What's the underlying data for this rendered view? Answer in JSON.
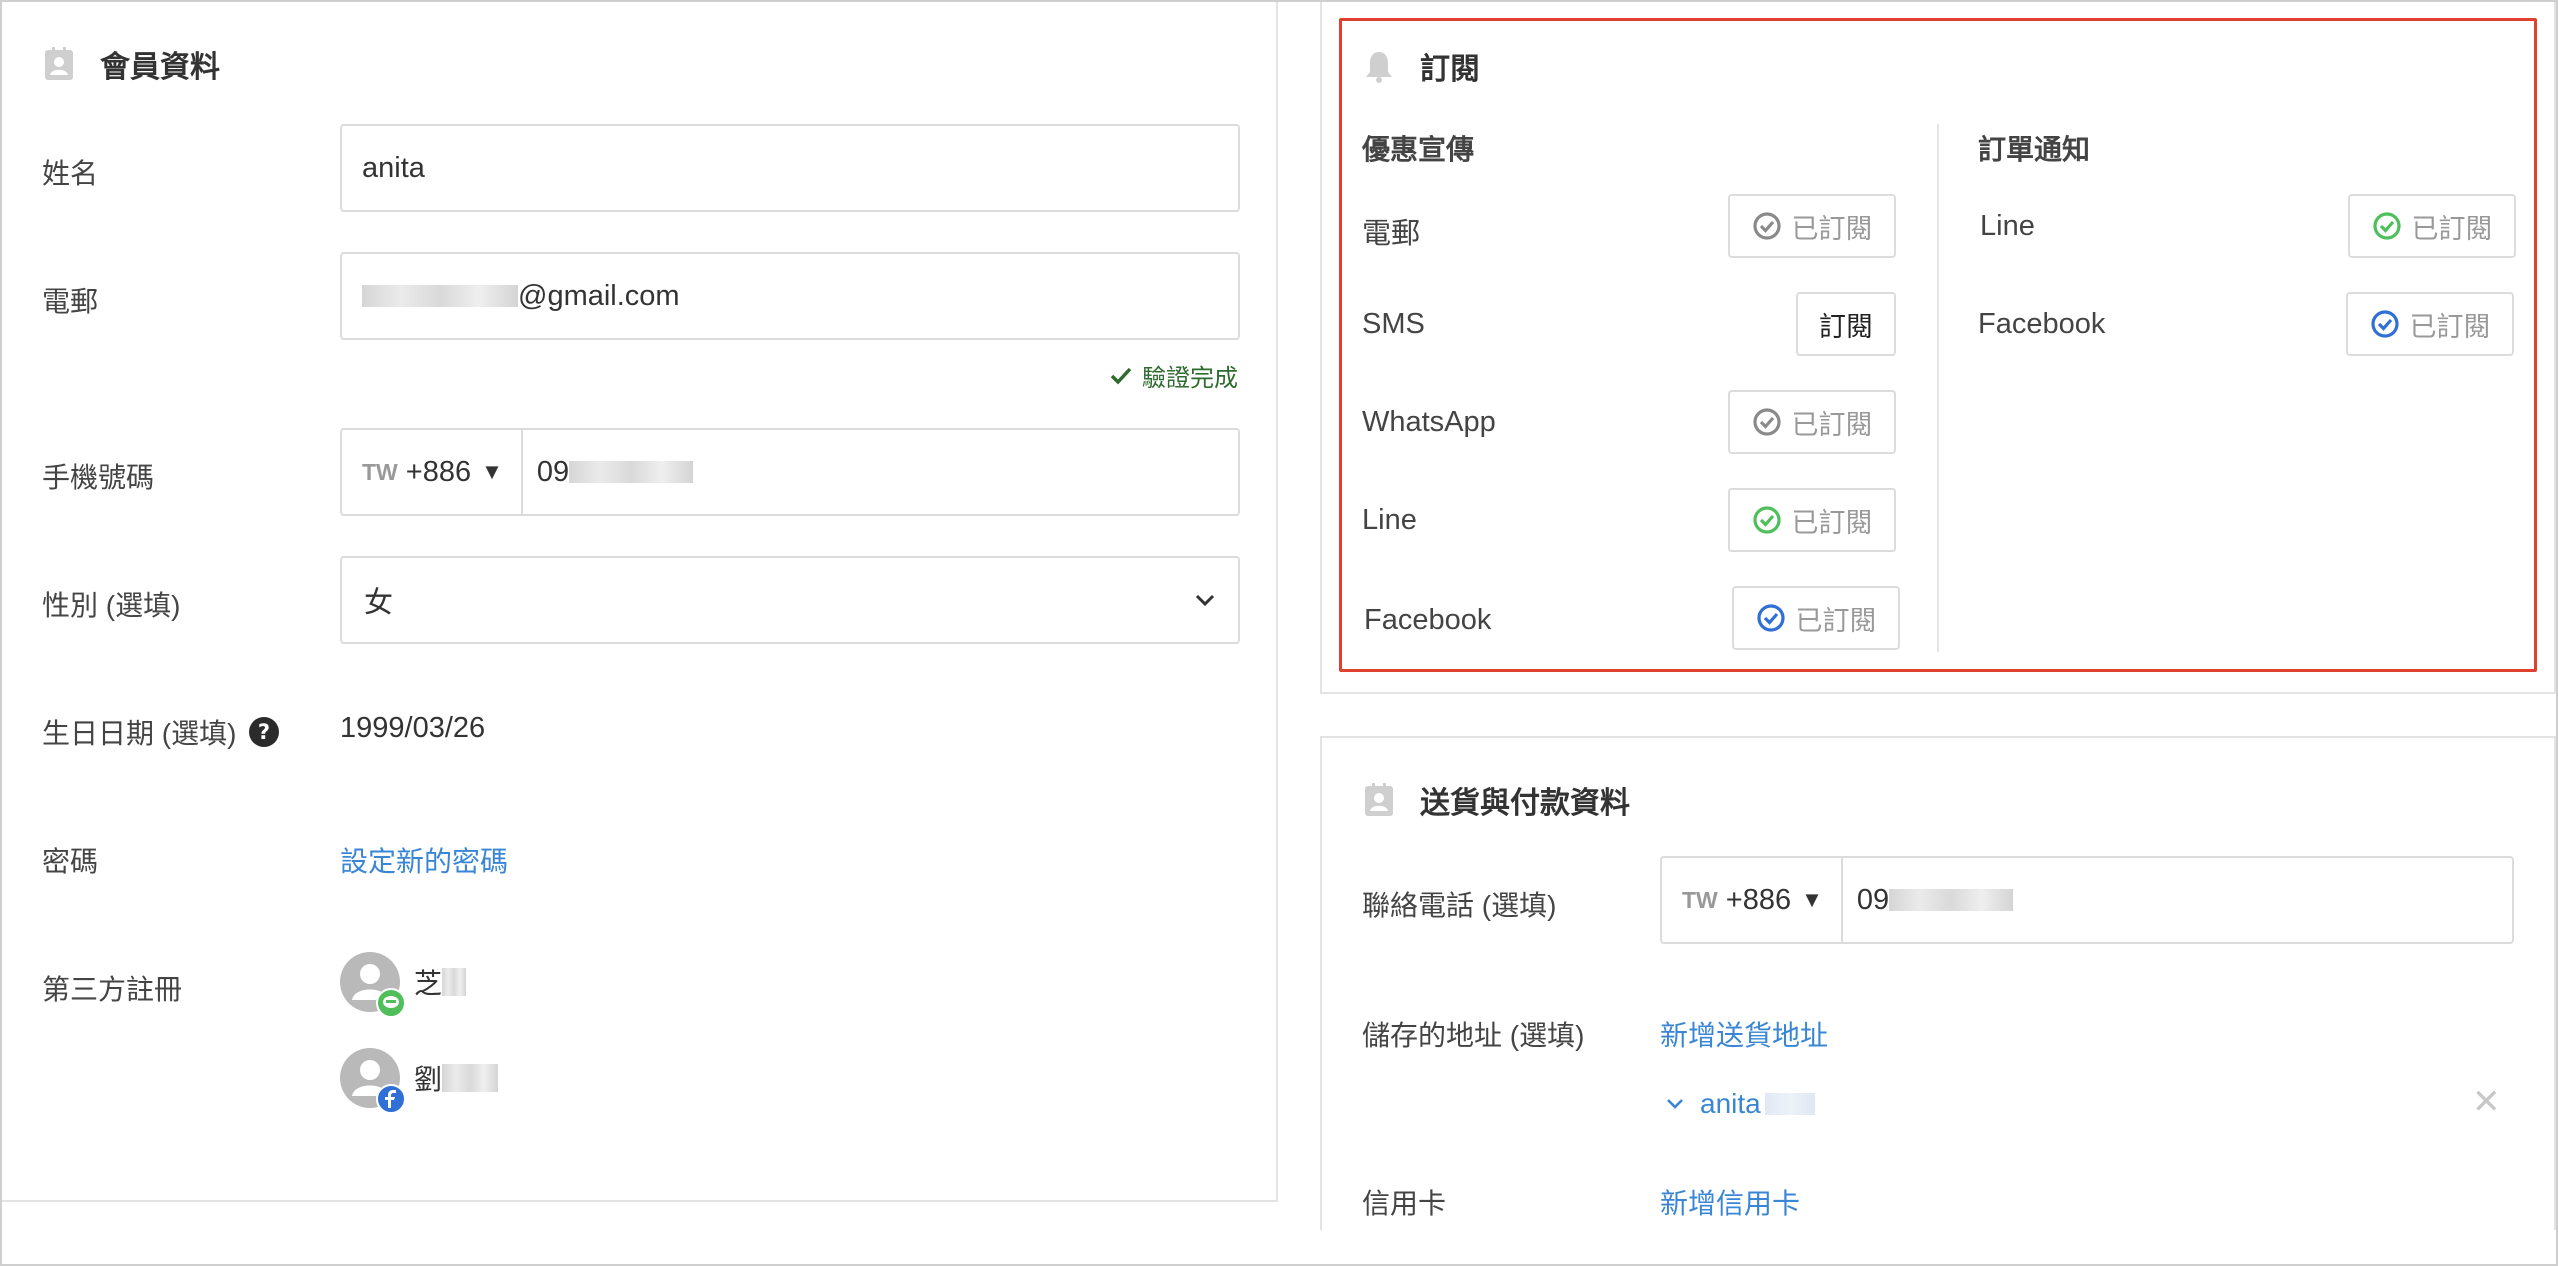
{
  "member": {
    "title": "會員資料",
    "name_label": "姓名",
    "name_value": "anita",
    "email_label": "電郵",
    "email_value": "@gmail.com",
    "verified_text": "驗證完成",
    "mobile_label": "手機號碼",
    "mobile_cc_code": "TW",
    "mobile_cc": "+886",
    "mobile_value": "09",
    "gender_label": "性別 (選填)",
    "gender_value": "女",
    "birthday_label": "生日日期 (選填)",
    "birthday_value": "1999/03/26",
    "password_label": "密碼",
    "password_link": "設定新的密碼",
    "social_label": "第三方註冊",
    "social_accounts": [
      {
        "name": "芝",
        "provider": "line-icon"
      },
      {
        "name": "劉",
        "provider": "facebook-icon"
      }
    ]
  },
  "subscription": {
    "title": "訂閱",
    "promo_heading": "優惠宣傳",
    "order_heading": "訂單通知",
    "promo_items": [
      {
        "label": "電郵",
        "button": "已訂閱",
        "state": "subscribed",
        "icon_color": "#8a8a8a"
      },
      {
        "label": "SMS",
        "button": "訂閱",
        "state": "not-subscribed",
        "icon_color": ""
      },
      {
        "label": "WhatsApp",
        "button": "已訂閱",
        "state": "subscribed",
        "icon_color": "#8a8a8a"
      },
      {
        "label": "Line",
        "button": "已訂閱",
        "state": "subscribed",
        "icon_color": "#4fbf5a"
      },
      {
        "label": "Facebook",
        "button": "已訂閱",
        "state": "subscribed",
        "icon_color": "#2f6fd6"
      }
    ],
    "order_items": [
      {
        "label": "Line",
        "button": "已訂閱",
        "state": "subscribed",
        "icon_color": "#4fbf5a"
      },
      {
        "label": "Facebook",
        "button": "已訂閱",
        "state": "subscribed",
        "icon_color": "#2f6fd6"
      }
    ]
  },
  "shipping": {
    "title": "送貨與付款資料",
    "phone_label": "聯絡電話 (選填)",
    "phone_cc_code": "TW",
    "phone_cc": "+886",
    "phone_value": "09",
    "address_label": "儲存的地址 (選填)",
    "address_link": "新增送貨地址",
    "address_item": "anita",
    "card_label": "信用卡",
    "card_link": "新增信用卡"
  },
  "colors": {
    "accent_link": "#3a86d6",
    "highlight_border": "#e0412f",
    "verified_green": "#2e6b2e"
  }
}
